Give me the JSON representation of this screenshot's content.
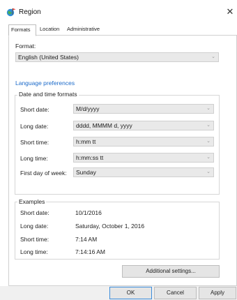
{
  "window": {
    "title": "Region",
    "icon": "globe-flag-icon",
    "close_glyph": "✕"
  },
  "tabs": [
    {
      "label": "Formats",
      "active": true
    },
    {
      "label": "Location",
      "active": false
    },
    {
      "label": "Administrative",
      "active": false
    }
  ],
  "format": {
    "label": "Format:",
    "value": "English (United States)"
  },
  "language_link": "Language preferences",
  "date_time": {
    "legend": "Date and time formats",
    "rows": [
      {
        "label": "Short date:",
        "value": "M/d/yyyy"
      },
      {
        "label": "Long date:",
        "value": "dddd, MMMM d, yyyy"
      },
      {
        "label": "Short time:",
        "value": "h:mm tt"
      },
      {
        "label": "Long time:",
        "value": "h:mm:ss tt"
      },
      {
        "label": "First day of week:",
        "value": "Sunday"
      }
    ]
  },
  "examples": {
    "legend": "Examples",
    "rows": [
      {
        "label": "Short date:",
        "value": "10/1/2016"
      },
      {
        "label": "Long date:",
        "value": "Saturday, October 1, 2016"
      },
      {
        "label": "Short time:",
        "value": "7:14 AM"
      },
      {
        "label": "Long time:",
        "value": "7:14:16 AM"
      }
    ]
  },
  "buttons": {
    "additional": "Additional settings...",
    "ok": "OK",
    "cancel": "Cancel",
    "apply": "Apply"
  },
  "chevron_glyph": "⌄"
}
